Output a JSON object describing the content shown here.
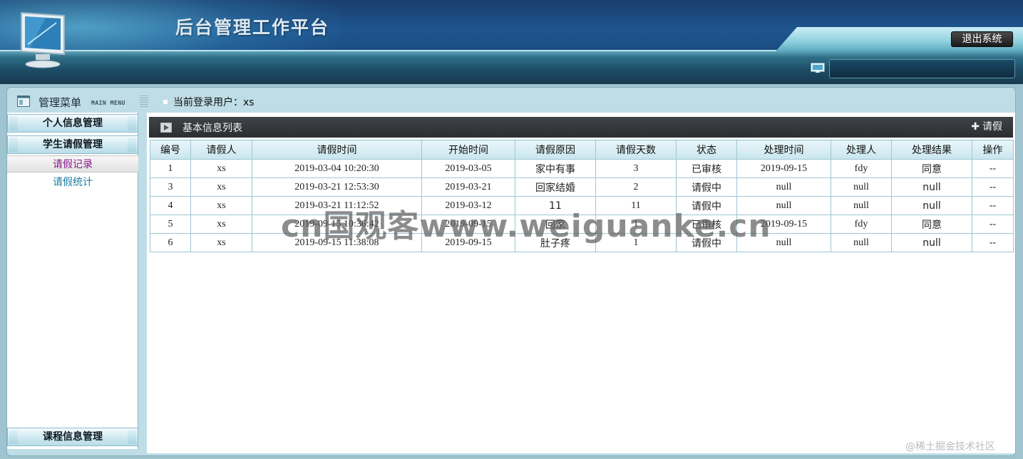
{
  "header": {
    "title": "后台管理工作平台",
    "logout_label": "退出系统"
  },
  "sidebar": {
    "title": "管理菜单",
    "subtitle": "MAIN MENU",
    "groups": [
      {
        "label": "个人信息管理"
      },
      {
        "label": "学生请假管理"
      },
      {
        "label": "课程信息管理"
      }
    ],
    "submenu": [
      {
        "label": "请假记录",
        "active": true
      },
      {
        "label": "请假统计",
        "active": false
      }
    ]
  },
  "userbar": {
    "label": "当前登录用户：xs"
  },
  "list": {
    "title": "基本信息列表",
    "add_label": "请假",
    "columns": [
      "编号",
      "请假人",
      "请假时间",
      "开始时间",
      "请假原因",
      "请假天数",
      "状态",
      "处理时间",
      "处理人",
      "处理结果",
      "操作"
    ],
    "rows": [
      [
        "1",
        "xs",
        "2019-03-04 10:20:30",
        "2019-03-05",
        "家中有事",
        "3",
        "已审核",
        "2019-09-15",
        "fdy",
        "同意",
        "--"
      ],
      [
        "3",
        "xs",
        "2019-03-21 12:53:30",
        "2019-03-21",
        "回家结婚",
        "2",
        "请假中",
        "null",
        "null",
        "null",
        "--"
      ],
      [
        "4",
        "xs",
        "2019-03-21 11:12:52",
        "2019-03-12",
        "11",
        "11",
        "请假中",
        "null",
        "null",
        "null",
        "--"
      ],
      [
        "5",
        "xs",
        "2019-09-15 10:36:42",
        "2019-09-15",
        "回家",
        "1",
        "已审核",
        "2019-09-15",
        "fdy",
        "同意",
        "--"
      ],
      [
        "6",
        "xs",
        "2019-09-15 11:38:08",
        "2019-09-15",
        "肚子疼",
        "1",
        "请假中",
        "null",
        "null",
        "null",
        "--"
      ]
    ]
  },
  "watermark": "cn国观客www.weiguanke.cn",
  "footer_watermark": "@稀土掘金技术社区"
}
